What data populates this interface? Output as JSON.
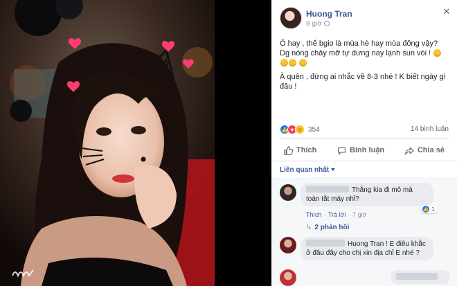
{
  "post": {
    "author": "Huong Tran",
    "time": "8 giờ",
    "text_line1": "Ô hay , thế bgio là mùa hè hay mùa đông vậy? Dg nóng chảy mỡ tự dưng nay lạnh sun vòi !",
    "text_line2": "À quên , đừng ai nhắc về 8-3 nhé ! K biết ngày gì đâu !",
    "reaction_count": "354",
    "comment_count": "14 bình luận"
  },
  "actions": {
    "like": "Thích",
    "comment": "Bình luận",
    "share": "Chia sẻ"
  },
  "sort_label": "Liên quan nhất",
  "comments": [
    {
      "text": "Thằng kia đi mô mà toàn tắt máy nhỉ?",
      "like": "Thích",
      "reply": "Trả lời",
      "time": "7 giờ",
      "likes": "1",
      "replies": "2 phản hồi"
    },
    {
      "text": "Huong Tran ! E điêu khắc ở đâu đây cho chị xin địa chỉ E nhé ?"
    }
  ],
  "icons": {
    "close": "close-icon",
    "like": "thumbs-up-icon",
    "comment": "comment-icon",
    "share": "share-icon"
  },
  "colors": {
    "link": "#385898",
    "like_blue": "#1877f2",
    "love_red": "#f33e58",
    "haha_yellow": "#f7c52b"
  }
}
